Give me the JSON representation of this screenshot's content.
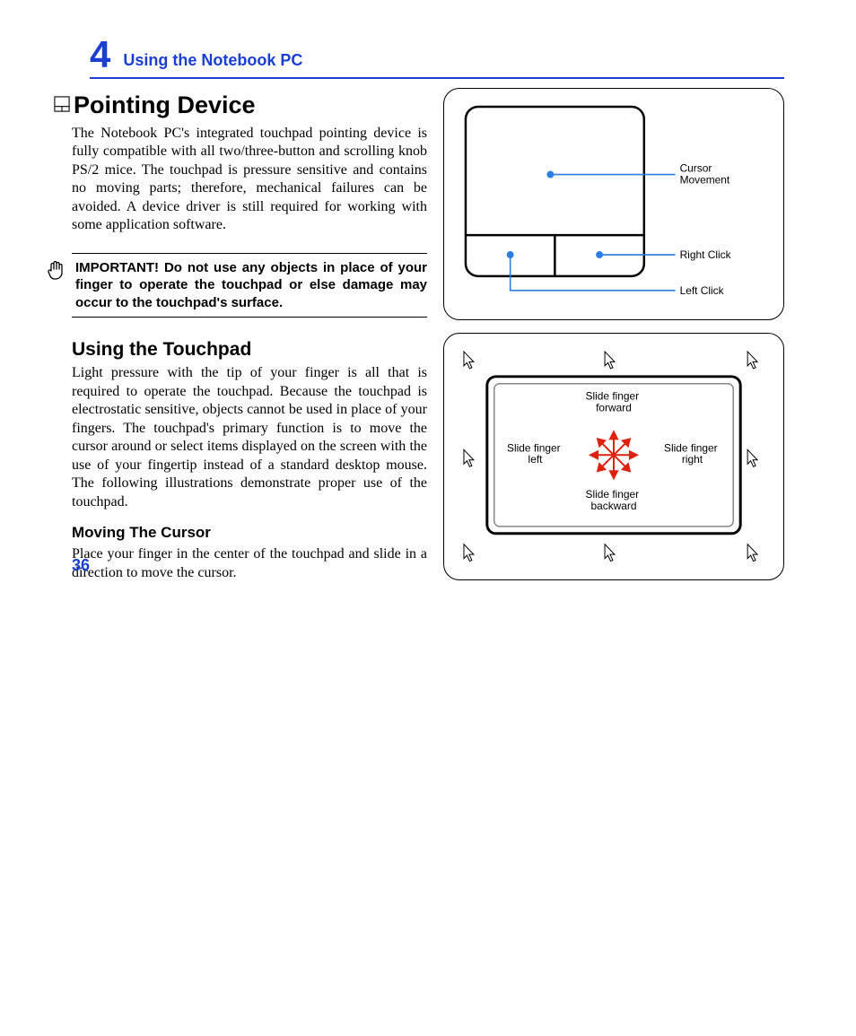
{
  "chapter": {
    "number": "4",
    "title": "Using the Notebook PC"
  },
  "section": {
    "h1": "Pointing Device",
    "intro": "The Notebook PC's integrated touchpad pointing device is fully compatible with all two/three-button and scrolling knob PS/2 mice. The touchpad is pressure sensitive and contains no moving parts; therefore, mechanical failures can be avoided. A device driver is still required for working with some application software.",
    "note": "IMPORTANT! Do not use any objects in place of your finger to operate the touchpad or else damage may occur to the touchpad's surface.",
    "h2": "Using the Touchpad",
    "p2": "Light pressure with the tip of your finger is all that is required to operate the touchpad. Because the touchpad is electrostatic sensitive, objects cannot be used in place of your fingers. The touchpad's primary function is to move the cursor around or select items displayed on the screen with the use of your fingertip instead of a standard desktop mouse. The following illustrations demonstrate proper use of the touchpad.",
    "h3": "Moving The Cursor",
    "p3": "Place your finger in the center of the touchpad and slide in a direction to move the cursor."
  },
  "diagram1": {
    "cursor_movement": "Cursor\nMovement",
    "right_click": "Right Click",
    "left_click": "Left Click"
  },
  "diagram2": {
    "forward": "Slide finger\nforward",
    "backward": "Slide finger\nbackward",
    "left": "Slide finger\nleft",
    "right": "Slide finger\nright"
  },
  "page_number": "36"
}
